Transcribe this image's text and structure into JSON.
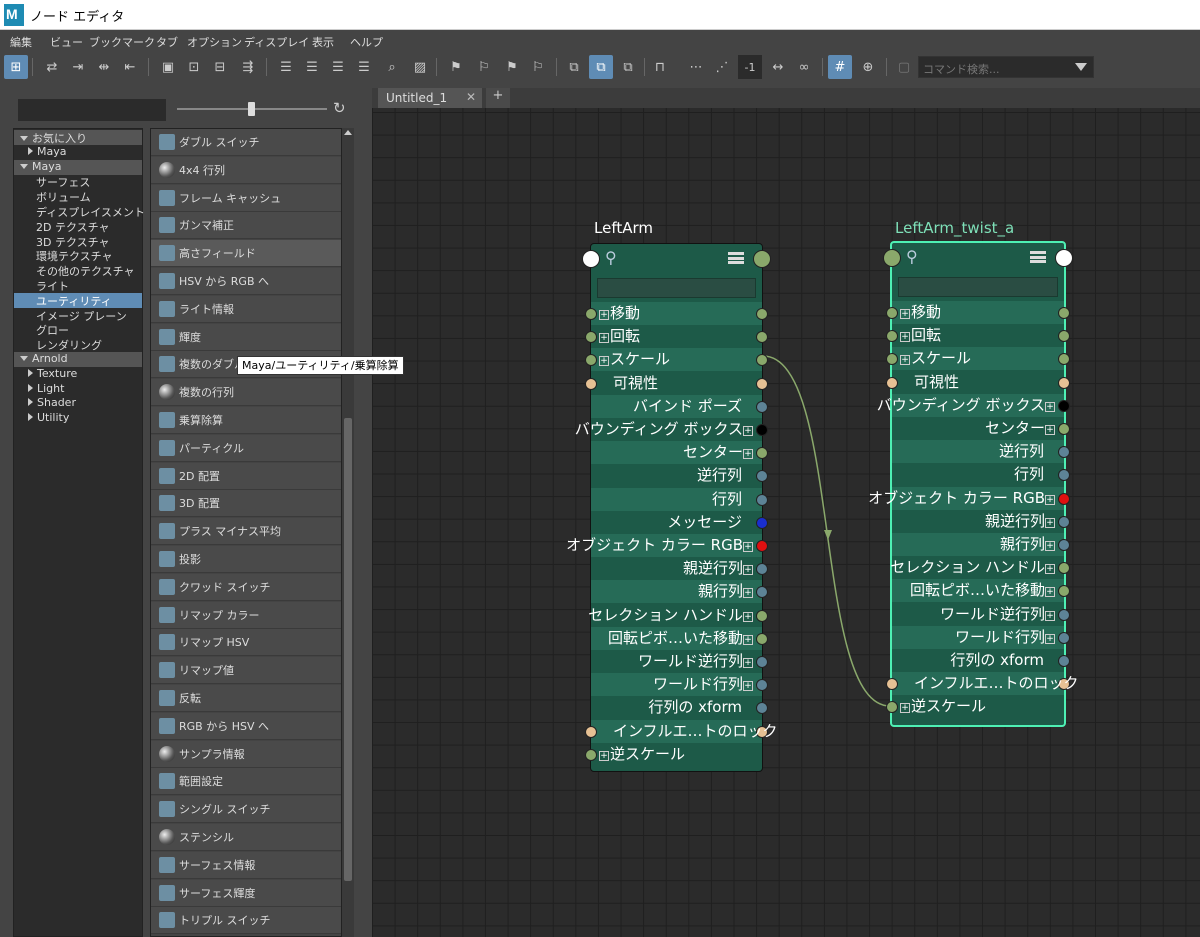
{
  "window": {
    "title": "ノード エディタ"
  },
  "menubar": [
    "編集",
    "ビュー",
    "ブックマーク",
    "タブ",
    "オプション",
    "ディスプレイ",
    "表示",
    "ヘルプ"
  ],
  "toolbar": {
    "minus_one": "-1",
    "search_placeholder": "コマンド検索..."
  },
  "left_panel": {
    "tree": [
      {
        "label": "お気に入り",
        "kind": "cat"
      },
      {
        "label": "Maya",
        "kind": "child"
      },
      {
        "label": "Maya",
        "kind": "cat"
      },
      {
        "label": "サーフェス",
        "kind": "leaf"
      },
      {
        "label": "ボリューム",
        "kind": "leaf"
      },
      {
        "label": "ディスプレイスメント",
        "kind": "leaf"
      },
      {
        "label": "2D テクスチャ",
        "kind": "leaf"
      },
      {
        "label": "3D テクスチャ",
        "kind": "leaf"
      },
      {
        "label": "環境テクスチャ",
        "kind": "leaf"
      },
      {
        "label": "その他のテクスチャ",
        "kind": "leaf"
      },
      {
        "label": "ライト",
        "kind": "leaf"
      },
      {
        "label": "ユーティリティ",
        "kind": "sel"
      },
      {
        "label": "イメージ プレーン",
        "kind": "leaf"
      },
      {
        "label": "グロー",
        "kind": "leaf"
      },
      {
        "label": "レンダリング",
        "kind": "leaf"
      },
      {
        "label": "Arnold",
        "kind": "cat"
      },
      {
        "label": "Texture",
        "kind": "child"
      },
      {
        "label": "Light",
        "kind": "child"
      },
      {
        "label": "Shader",
        "kind": "child"
      },
      {
        "label": "Utility",
        "kind": "child"
      }
    ],
    "nodes": [
      "ダブル スイッチ",
      "4x4 行列",
      "フレーム キャッシュ",
      "ガンマ補正",
      "高さフィールド",
      "HSV から RGB へ",
      "ライト情報",
      "輝度",
      "複数のダブル リニア",
      "複数の行列",
      "乗算除算",
      "パーティクル",
      "2D 配置",
      "3D 配置",
      "プラス マイナス平均",
      "投影",
      "クワッド スイッチ",
      "リマップ カラー",
      "リマップ HSV",
      "リマップ値",
      "反転",
      "RGB から HSV へ",
      "サンプラ情報",
      "範囲設定",
      "シングル スイッチ",
      "ステンシル",
      "サーフェス情報",
      "サーフェス輝度",
      "トリプル スイッチ"
    ],
    "tooltip": "Maya/ユーティリティ/乗算除算"
  },
  "tabs": [
    {
      "label": "Untitled_1"
    }
  ],
  "graph": {
    "node_a": {
      "title": "LeftArm",
      "ports": [
        {
          "label": "移動",
          "side": "in",
          "plus": true,
          "in": "#8aa86b",
          "out": "#8aa86b"
        },
        {
          "label": "回転",
          "side": "in",
          "plus": true,
          "in": "#8aa86b",
          "out": "#8aa86b"
        },
        {
          "label": "スケール",
          "side": "in",
          "plus": true,
          "in": "#8aa86b",
          "out": "#8aa86b"
        },
        {
          "label": "可視性",
          "side": "in",
          "plus": false,
          "in": "#e6c194",
          "out": "#e6c194"
        },
        {
          "label": "バインド ポーズ",
          "side": "out",
          "plus": false,
          "out": "#5d8396"
        },
        {
          "label": "バウンディング ボックス",
          "side": "out",
          "plus": true,
          "out": "#000000"
        },
        {
          "label": "センター",
          "side": "out",
          "plus": true,
          "out": "#8aa86b"
        },
        {
          "label": "逆行列",
          "side": "out",
          "plus": false,
          "out": "#5d8396"
        },
        {
          "label": "行列",
          "side": "out",
          "plus": false,
          "out": "#5d8396"
        },
        {
          "label": "メッセージ",
          "side": "out",
          "plus": false,
          "out": "#1a2ecf"
        },
        {
          "label": "オブジェクト カラー RGB",
          "side": "out",
          "plus": true,
          "out": "#e01010"
        },
        {
          "label": "親逆行列",
          "side": "out",
          "plus": true,
          "out": "#5d8396"
        },
        {
          "label": "親行列",
          "side": "out",
          "plus": true,
          "out": "#5d8396"
        },
        {
          "label": "セレクション ハンドル",
          "side": "out",
          "plus": true,
          "out": "#8aa86b"
        },
        {
          "label": "回転ピボ…いた移動",
          "side": "out",
          "plus": true,
          "out": "#8aa86b"
        },
        {
          "label": "ワールド逆行列",
          "side": "out",
          "plus": true,
          "out": "#5d8396"
        },
        {
          "label": "ワールド行列",
          "side": "out",
          "plus": true,
          "out": "#5d8396"
        },
        {
          "label": "行列の xform",
          "side": "out",
          "plus": false,
          "out": "#5d8396"
        },
        {
          "label": "インフルエ…トのロック",
          "side": "in",
          "plus": false,
          "in": "#e6c194",
          "out": "#e6c194"
        },
        {
          "label": "逆スケール",
          "side": "in",
          "plus": true,
          "in": "#8aa86b"
        }
      ]
    },
    "node_b": {
      "title": "LeftArm_twist_a",
      "ports": [
        {
          "label": "移動",
          "side": "in",
          "plus": true,
          "in": "#8aa86b",
          "out": "#8aa86b"
        },
        {
          "label": "回転",
          "side": "in",
          "plus": true,
          "in": "#8aa86b",
          "out": "#8aa86b"
        },
        {
          "label": "スケール",
          "side": "in",
          "plus": true,
          "in": "#8aa86b",
          "out": "#8aa86b"
        },
        {
          "label": "可視性",
          "side": "in",
          "plus": false,
          "in": "#e6c194",
          "out": "#e6c194"
        },
        {
          "label": "バウンディング ボックス",
          "side": "out",
          "plus": true,
          "out": "#000000"
        },
        {
          "label": "センター",
          "side": "out",
          "plus": true,
          "out": "#8aa86b"
        },
        {
          "label": "逆行列",
          "side": "out",
          "plus": false,
          "out": "#5d8396"
        },
        {
          "label": "行列",
          "side": "out",
          "plus": false,
          "out": "#5d8396"
        },
        {
          "label": "オブジェクト カラー RGB",
          "side": "out",
          "plus": true,
          "out": "#e01010"
        },
        {
          "label": "親逆行列",
          "side": "out",
          "plus": true,
          "out": "#5d8396"
        },
        {
          "label": "親行列",
          "side": "out",
          "plus": true,
          "out": "#5d8396"
        },
        {
          "label": "セレクション ハンドル",
          "side": "out",
          "plus": true,
          "out": "#8aa86b"
        },
        {
          "label": "回転ピボ…いた移動",
          "side": "out",
          "plus": true,
          "out": "#8aa86b"
        },
        {
          "label": "ワールド逆行列",
          "side": "out",
          "plus": true,
          "out": "#5d8396"
        },
        {
          "label": "ワールド行列",
          "side": "out",
          "plus": true,
          "out": "#5d8396"
        },
        {
          "label": "行列の xform",
          "side": "out",
          "plus": false,
          "out": "#5d8396"
        },
        {
          "label": "インフルエ…トのロック",
          "side": "in",
          "plus": false,
          "in": "#e6c194",
          "out": "#e6c194"
        },
        {
          "label": "逆スケール",
          "side": "in",
          "plus": true,
          "in": "#8aa86b"
        }
      ]
    }
  }
}
